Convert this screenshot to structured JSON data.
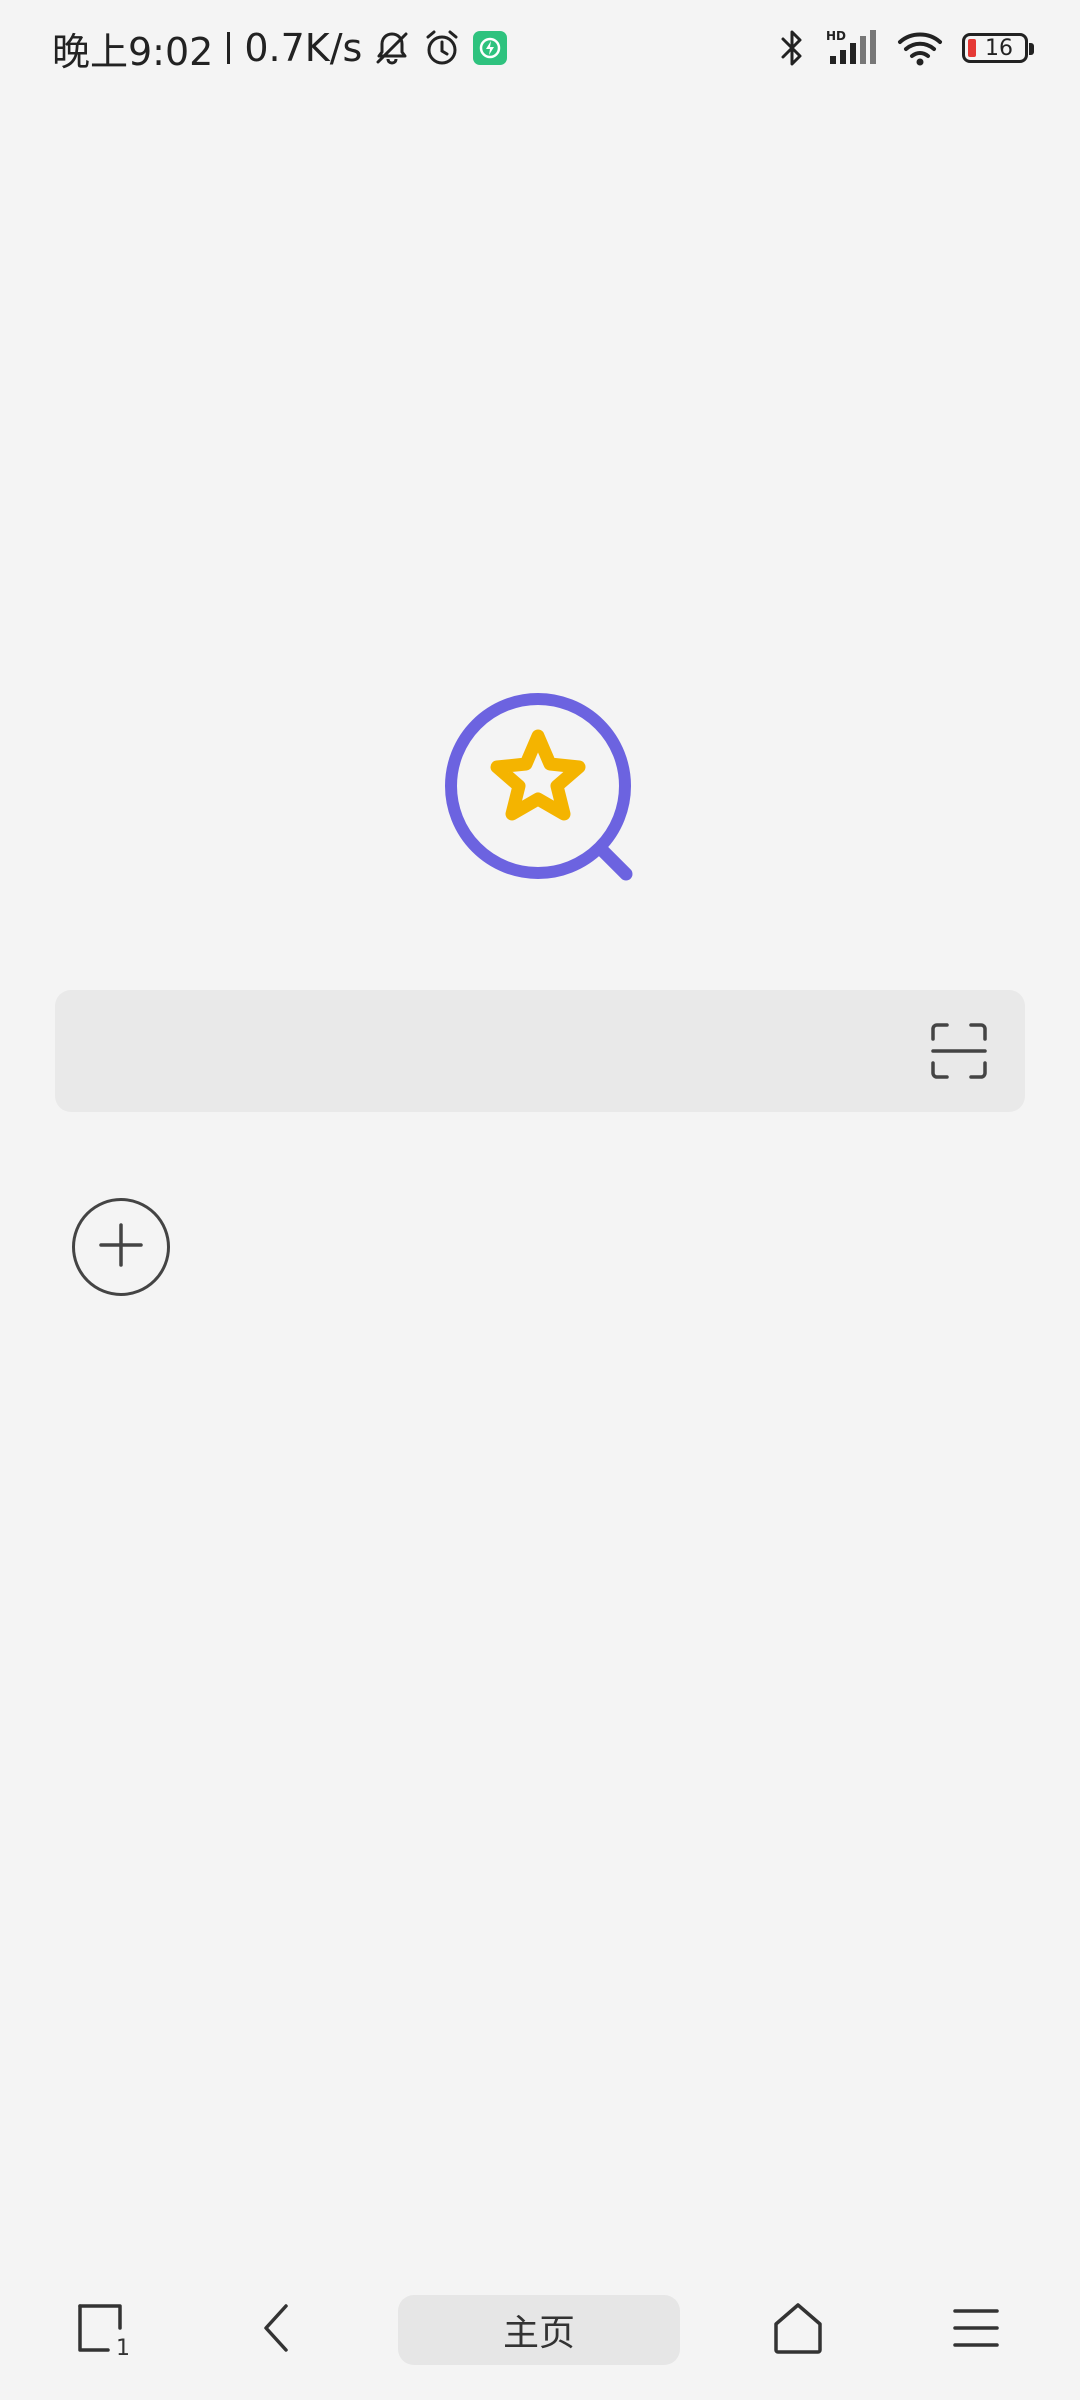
{
  "status_bar": {
    "time": "晚上9:02",
    "network_speed": "0.7K/s",
    "battery_level": "16",
    "icons": [
      "bell-off-icon",
      "alarm-icon",
      "app-notification-icon",
      "bluetooth-icon",
      "hd-signal-icon",
      "wifi-icon",
      "battery-icon"
    ],
    "hd_label": "HD"
  },
  "logo": {
    "icon": "search-star-logo-icon",
    "ring_color": "#6c63e0",
    "star_color": "#f4b400"
  },
  "search": {
    "value": "",
    "placeholder": "",
    "scan_icon": "scan-icon"
  },
  "shortcuts": {
    "add_icon": "plus-circle-icon"
  },
  "bottom_nav": {
    "tab_count": "1",
    "home_label": "主页",
    "icons": [
      "tabs-icon",
      "back-icon",
      "home-icon",
      "menu-icon"
    ]
  }
}
